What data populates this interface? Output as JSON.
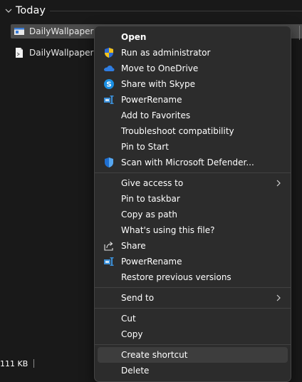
{
  "explorer": {
    "group_header": "Today",
    "files": [
      {
        "name": "DailyWallpapers.e",
        "icon": "exe-file-icon",
        "selected": true
      },
      {
        "name": "DailyWallpapers.p",
        "icon": "ps1-file-icon",
        "selected": false
      }
    ],
    "status": {
      "size_text": "111 KB"
    }
  },
  "context_menu": {
    "group1": [
      {
        "label": "Open",
        "icon": "",
        "bold": true
      },
      {
        "label": "Run as administrator",
        "icon": "uac-shield-icon"
      },
      {
        "label": "Move to OneDrive",
        "icon": "onedrive-cloud-icon"
      },
      {
        "label": "Share with Skype",
        "icon": "skype-icon"
      },
      {
        "label": "PowerRename",
        "icon": "powerrename-icon"
      },
      {
        "label": "Add to Favorites",
        "icon": ""
      },
      {
        "label": "Troubleshoot compatibility",
        "icon": ""
      },
      {
        "label": "Pin to Start",
        "icon": ""
      },
      {
        "label": "Scan with Microsoft Defender...",
        "icon": "defender-shield-icon"
      }
    ],
    "group2": [
      {
        "label": "Give access to",
        "icon": "",
        "submenu": true
      },
      {
        "label": "Pin to taskbar",
        "icon": ""
      },
      {
        "label": "Copy as path",
        "icon": ""
      },
      {
        "label": "What's using this file?",
        "icon": ""
      },
      {
        "label": "Share",
        "icon": "share-icon"
      },
      {
        "label": "PowerRename",
        "icon": "powerrename-icon"
      },
      {
        "label": "Restore previous versions",
        "icon": ""
      }
    ],
    "group3": [
      {
        "label": "Send to",
        "icon": "",
        "submenu": true
      }
    ],
    "group4": [
      {
        "label": "Cut",
        "icon": ""
      },
      {
        "label": "Copy",
        "icon": ""
      }
    ],
    "group5": [
      {
        "label": "Create shortcut",
        "icon": "",
        "hover": true
      },
      {
        "label": "Delete",
        "icon": ""
      }
    ]
  },
  "colors": {
    "background": "#191919",
    "menu_background": "#2c2c2c",
    "hover": "#3d3d3d",
    "selection": "#4b4b4b",
    "onedrive_blue": "#2f7de1",
    "skype_blue": "#1a8fe3",
    "powerrename_blue": "#3b8fd8"
  }
}
